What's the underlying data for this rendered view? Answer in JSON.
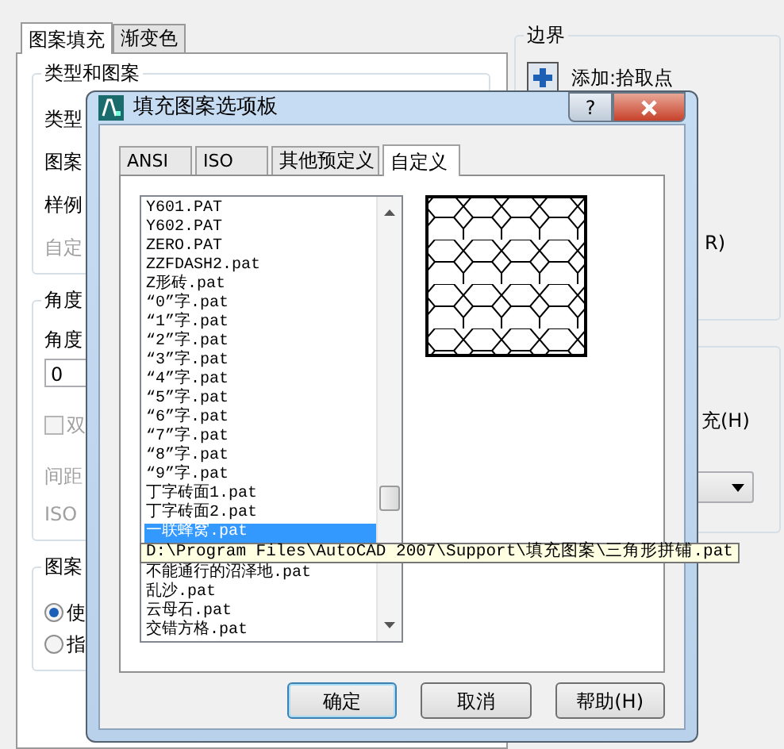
{
  "hatch_dialog": {
    "tabs": [
      {
        "label": "图案填充",
        "selected": true
      },
      {
        "label": "渐变色",
        "selected": false
      }
    ],
    "type_group": {
      "title": "类型和图案",
      "rows": [
        {
          "label": "类型",
          "disabled": false
        },
        {
          "label": "图案",
          "disabled": false
        },
        {
          "label": "样例",
          "disabled": false
        },
        {
          "label": "自定",
          "disabled": true
        }
      ]
    },
    "angle_group": {
      "title": "角度",
      "angle_label": "角度",
      "angle_value": "0",
      "double_checkbox": {
        "label": "双",
        "checked": false,
        "disabled": true
      },
      "spacing_label": "间距",
      "iso_label": "ISO"
    },
    "origin_group": {
      "title": "图案",
      "radios": [
        {
          "label": "使",
          "selected": true
        },
        {
          "label": "指",
          "selected": false
        }
      ]
    },
    "boundary_group": {
      "title": "边界",
      "add_pick_points": "添加:拾取点",
      "partial_text": "R)"
    },
    "options_group": {
      "partial_text": "充(H)"
    }
  },
  "palette": {
    "title": "填充图案选项板",
    "help_glyph": "?",
    "tabs": [
      {
        "label": "ANSI",
        "selected": false
      },
      {
        "label": "ISO",
        "selected": false
      },
      {
        "label": "其他预定义",
        "selected": false
      },
      {
        "label": "自定义",
        "selected": true
      }
    ],
    "files": [
      {
        "name": "Y601.PAT",
        "selected": false
      },
      {
        "name": "Y602.PAT",
        "selected": false
      },
      {
        "name": "ZERO.PAT",
        "selected": false
      },
      {
        "name": "ZZFDASH2.pat",
        "selected": false
      },
      {
        "name": "Z形砖.pat",
        "selected": false
      },
      {
        "name": "“0”字.pat",
        "selected": false
      },
      {
        "name": "“1”字.pat",
        "selected": false
      },
      {
        "name": "“2”字.pat",
        "selected": false
      },
      {
        "name": "“3”字.pat",
        "selected": false
      },
      {
        "name": "“4”字.pat",
        "selected": false
      },
      {
        "name": "“5”字.pat",
        "selected": false
      },
      {
        "name": "“6”字.pat",
        "selected": false
      },
      {
        "name": "“7”字.pat",
        "selected": false
      },
      {
        "name": "“8”字.pat",
        "selected": false
      },
      {
        "name": "“9”字.pat",
        "selected": false
      },
      {
        "name": "丁字砖面1.pat",
        "selected": false
      },
      {
        "name": "丁字砖面2.pat",
        "selected": false
      },
      {
        "name": "一联蜂窝.pat",
        "selected": true
      },
      {
        "name": "不能通行的沼泽地.pat",
        "selected": false
      },
      {
        "name": "乱沙.pat",
        "selected": false
      },
      {
        "name": "云母石.pat",
        "selected": false
      },
      {
        "name": "交错方格.pat",
        "selected": false
      }
    ],
    "tooltip": "D:\\Program Files\\AutoCAD 2007\\Support\\填充图案\\三角形拼铺.pat",
    "buttons": [
      "确定",
      "取消",
      "帮助(H)"
    ]
  }
}
